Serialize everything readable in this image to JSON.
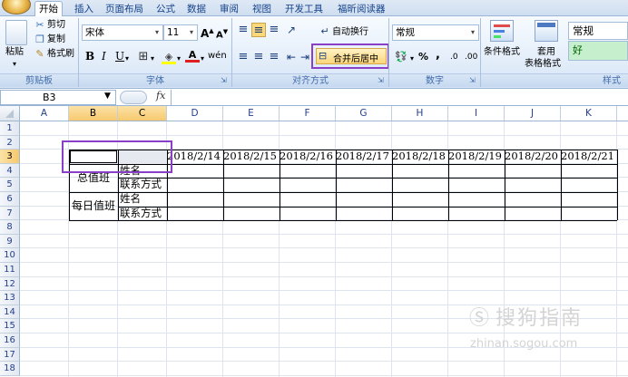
{
  "tabs": [
    {
      "label": "开始",
      "active": true
    },
    {
      "label": "插入"
    },
    {
      "label": "页面布局"
    },
    {
      "label": "公式"
    },
    {
      "label": "数据"
    },
    {
      "label": "审阅"
    },
    {
      "label": "视图"
    },
    {
      "label": "开发工具"
    },
    {
      "label": "福昕阅读器"
    }
  ],
  "ribbon": {
    "clipboard": {
      "paste": "粘贴",
      "cut": "剪切",
      "copy": "复制",
      "format_painter": "格式刷",
      "group": "剪贴板"
    },
    "font": {
      "name": "宋体",
      "size": "11",
      "grow": "A",
      "shrink": "A",
      "bold": "B",
      "italic": "I",
      "underline": "U",
      "group": "字体",
      "phonetic": "wén"
    },
    "alignment": {
      "wrap": "自动换行",
      "merge": "合并后居中",
      "group": "对齐方式"
    },
    "number": {
      "format": "常规",
      "percent": "%",
      "comma": ",",
      "inc": ".0",
      "dec": ".00",
      "group": "数字"
    },
    "styles": {
      "cond": "条件格式",
      "table": "套用",
      "table2": "表格格式",
      "normal": "常规",
      "good": "好",
      "group": "样式"
    }
  },
  "formula_bar": {
    "name_box": "B3",
    "fx": "fx",
    "value": ""
  },
  "columns": [
    "A",
    "B",
    "C",
    "D",
    "E",
    "F",
    "G",
    "H",
    "I",
    "J",
    "K"
  ],
  "rows": [
    "1",
    "2",
    "3",
    "4",
    "5",
    "6",
    "7",
    "8",
    "9",
    "10",
    "11",
    "12",
    "13",
    "14",
    "15",
    "16",
    "17",
    "18"
  ],
  "cells": {
    "D3": "2018/2/14",
    "E3": "2018/2/15",
    "F3": "2018/2/16",
    "G3": "2018/2/17",
    "H3": "2018/2/18",
    "I3": "2018/2/19",
    "J3": "2018/2/20",
    "K3": "2018/2/21",
    "B4": "总值班",
    "C4": "姓名",
    "C5": "联系方式",
    "B6": "每日值班",
    "C6": "姓名",
    "C7": "联系方式"
  },
  "watermark": {
    "brand": "搜狗指南",
    "url": "zhinan.sogou.com"
  },
  "colors": {
    "accent_highlight": "#8a3fc7",
    "good_style": "#c6efce",
    "selected_header": "#f7c86c"
  }
}
